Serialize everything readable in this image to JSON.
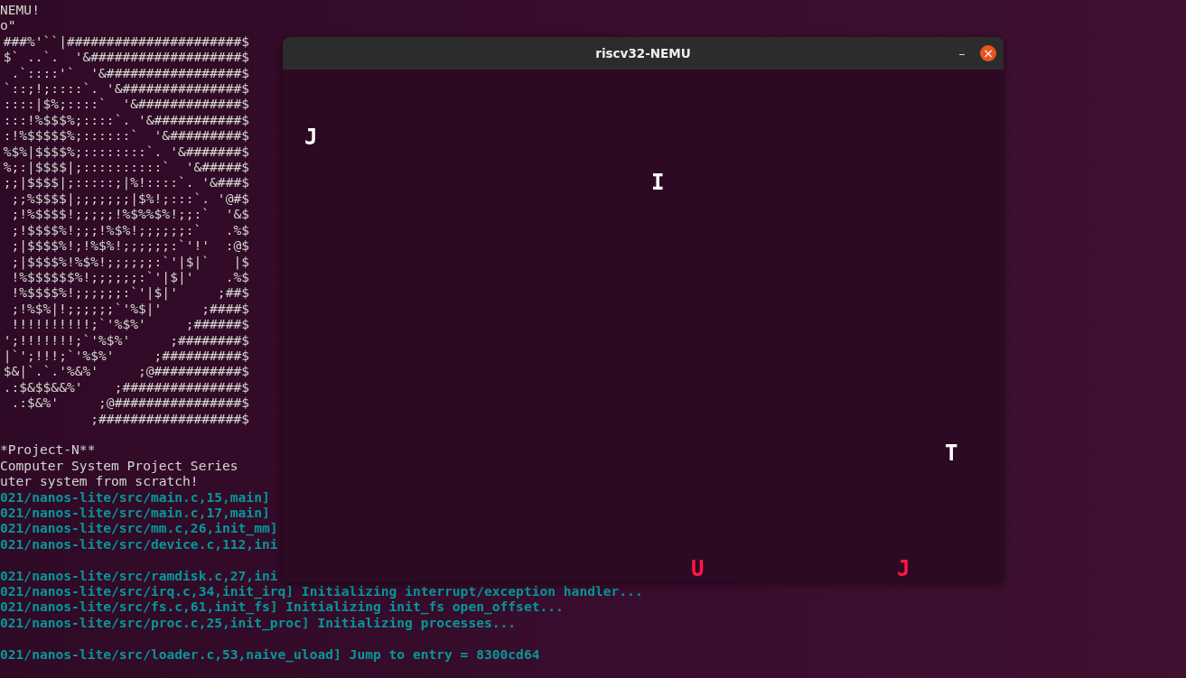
{
  "terminal": {
    "lines": [
      {
        "kind": "plain",
        "text": "NEMU!"
      },
      {
        "kind": "plain",
        "text": "o\""
      },
      {
        "kind": "art",
        "text": "###%'``|######################$"
      },
      {
        "kind": "art",
        "text": "$` ..`.  '&###################$"
      },
      {
        "kind": "art",
        "text": ".`::::'`  '&#################$"
      },
      {
        "kind": "art",
        "text": "`::;!;::::`. '&###############$"
      },
      {
        "kind": "art",
        "text": "::::|$%;::::`  '&#############$"
      },
      {
        "kind": "art",
        "text": ":::!%$$$%;::::`. '&###########$"
      },
      {
        "kind": "art",
        "text": ":!%$$$$$%;::::::`  '&#########$"
      },
      {
        "kind": "art",
        "text": "%$%|$$$$%;::::::::`. '&#######$"
      },
      {
        "kind": "art",
        "text": "%;:|$$$$|;::::::::::`  '&#####$"
      },
      {
        "kind": "art",
        "text": ";;|$$$$|;:::::;|%!::::`. '&###$"
      },
      {
        "kind": "art",
        "text": ";;%$$$$|;;;;;;;|$%!;:::`. '@#$"
      },
      {
        "kind": "art",
        "text": ";!%$$$$!;;;;;!%$%%$%!;;:`  '&$"
      },
      {
        "kind": "art",
        "text": ";!$$$$%!;;;!%$%!;;;;;;:`   .%$"
      },
      {
        "kind": "art",
        "text": ";|$$$$%!;!%$%!;;;;;;:`'!'  :@$"
      },
      {
        "kind": "art",
        "text": ";|$$$$%!%$%!;;;;;;:`'|$|`   |$"
      },
      {
        "kind": "art",
        "text": "!%$$$$$$%!;;;;;;:`'|$|'    .%$"
      },
      {
        "kind": "art",
        "text": "!%$$$$%!;;;;;;:`'|$|'     ;##$"
      },
      {
        "kind": "art",
        "text": ";!%$%|!;;;;;;`'%$|'     ;####$"
      },
      {
        "kind": "art",
        "text": "!!!!!!!!!!;`'%$%'     ;######$"
      },
      {
        "kind": "art",
        "text": "';!!!!!!!;`'%$%'     ;########$"
      },
      {
        "kind": "art",
        "text": "|`';!!!;`'%$%'     ;##########$"
      },
      {
        "kind": "art",
        "text": "$&|`.`.'%&%'     ;@###########$"
      },
      {
        "kind": "art",
        "text": ".:$&$$&&%'    ;###############$"
      },
      {
        "kind": "art",
        "text": ".:$&%'     ;@################$"
      },
      {
        "kind": "art",
        "text": ";##################$"
      },
      {
        "kind": "blank"
      },
      {
        "kind": "plain",
        "text": "*Project-N**"
      },
      {
        "kind": "plain",
        "text": "Computer System Project Series"
      },
      {
        "kind": "plain",
        "text": "uter system from scratch!"
      },
      {
        "kind": "info",
        "text": "021/nanos-lite/src/main.c,15,main]"
      },
      {
        "kind": "info",
        "text": "021/nanos-lite/src/main.c,17,main]"
      },
      {
        "kind": "info",
        "text": "021/nanos-lite/src/mm.c,26,init_mm]"
      },
      {
        "kind": "info",
        "text": "021/nanos-lite/src/device.c,112,ini"
      },
      {
        "kind": "blank"
      },
      {
        "kind": "info",
        "text": "021/nanos-lite/src/ramdisk.c,27,ini"
      },
      {
        "kind": "info",
        "text": "021/nanos-lite/src/irq.c,34,init_irq] Initializing interrupt/exception handler..."
      },
      {
        "kind": "info",
        "text": "021/nanos-lite/src/fs.c,61,init_fs] Initializing init_fs open_offset..."
      },
      {
        "kind": "info",
        "text": "021/nanos-lite/src/proc.c,25,init_proc] Initializing processes..."
      },
      {
        "kind": "blank"
      },
      {
        "kind": "info",
        "text": "021/nanos-lite/src/loader.c,53,naive_uload] Jump to entry = 8300cd64"
      }
    ]
  },
  "window": {
    "title": "riscv32-NEMU",
    "minimize": "–",
    "close": "×",
    "letters": [
      {
        "char": "J",
        "color": "#ffffff"
      },
      {
        "char": "I",
        "color": "#ffffff"
      },
      {
        "char": "T",
        "color": "#ffffff"
      },
      {
        "char": "U",
        "color": "#ff1744"
      },
      {
        "char": "J",
        "color": "#ff1744"
      }
    ]
  }
}
